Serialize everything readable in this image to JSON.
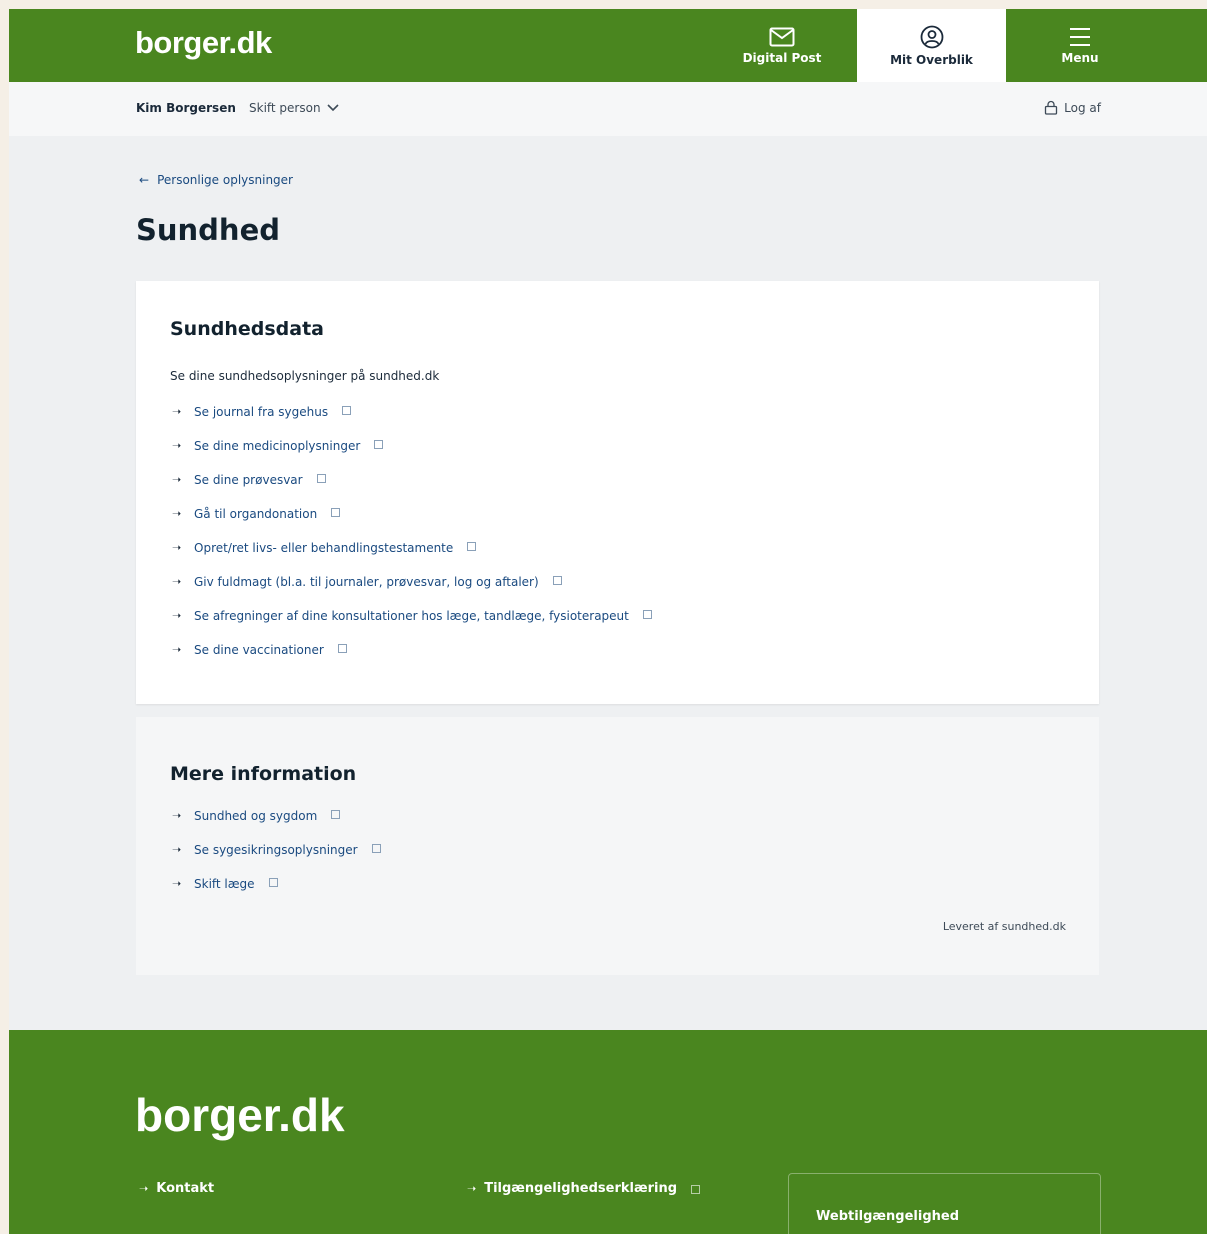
{
  "header": {
    "logo": "borger.dk",
    "nav": {
      "digital_post": "Digital Post",
      "mit_overblik": "Mit Overblik",
      "menu": "Menu"
    }
  },
  "subbar": {
    "user_name": "Kim Borgersen",
    "switch_person": "Skift person",
    "logout": "Log af"
  },
  "back_link": "Personlige oplysninger",
  "page_title": "Sundhed",
  "sundhedsdata": {
    "title": "Sundhedsdata",
    "intro": "Se dine sundhedsoplysninger på sundhed.dk",
    "links": [
      "Se journal fra sygehus",
      "Se dine medicinoplysninger",
      "Se dine prøvesvar",
      "Gå til organdonation",
      "Opret/ret livs- eller behandlingstestamente",
      "Giv fuldmagt (bl.a. til journaler, prøvesvar, log og aftaler)",
      "Se afregninger af dine konsultationer hos læge, tandlæge, fysioterapeut",
      "Se dine vaccinationer"
    ]
  },
  "mere_information": {
    "title": "Mere information",
    "links": [
      "Sundhed og sygdom",
      "Se sygesikringsoplysninger",
      "Skift læge"
    ],
    "provided_by": "Leveret af sundhed.dk"
  },
  "footer": {
    "logo": "borger.dk",
    "links": {
      "kontakt": "Kontakt",
      "tilgaengelighed": "Tilgængelighedserklæring"
    },
    "box_title": "Webtilgængelighed"
  },
  "colors": {
    "brand_green": "#4a861f",
    "link_blue": "#1a4a80"
  }
}
